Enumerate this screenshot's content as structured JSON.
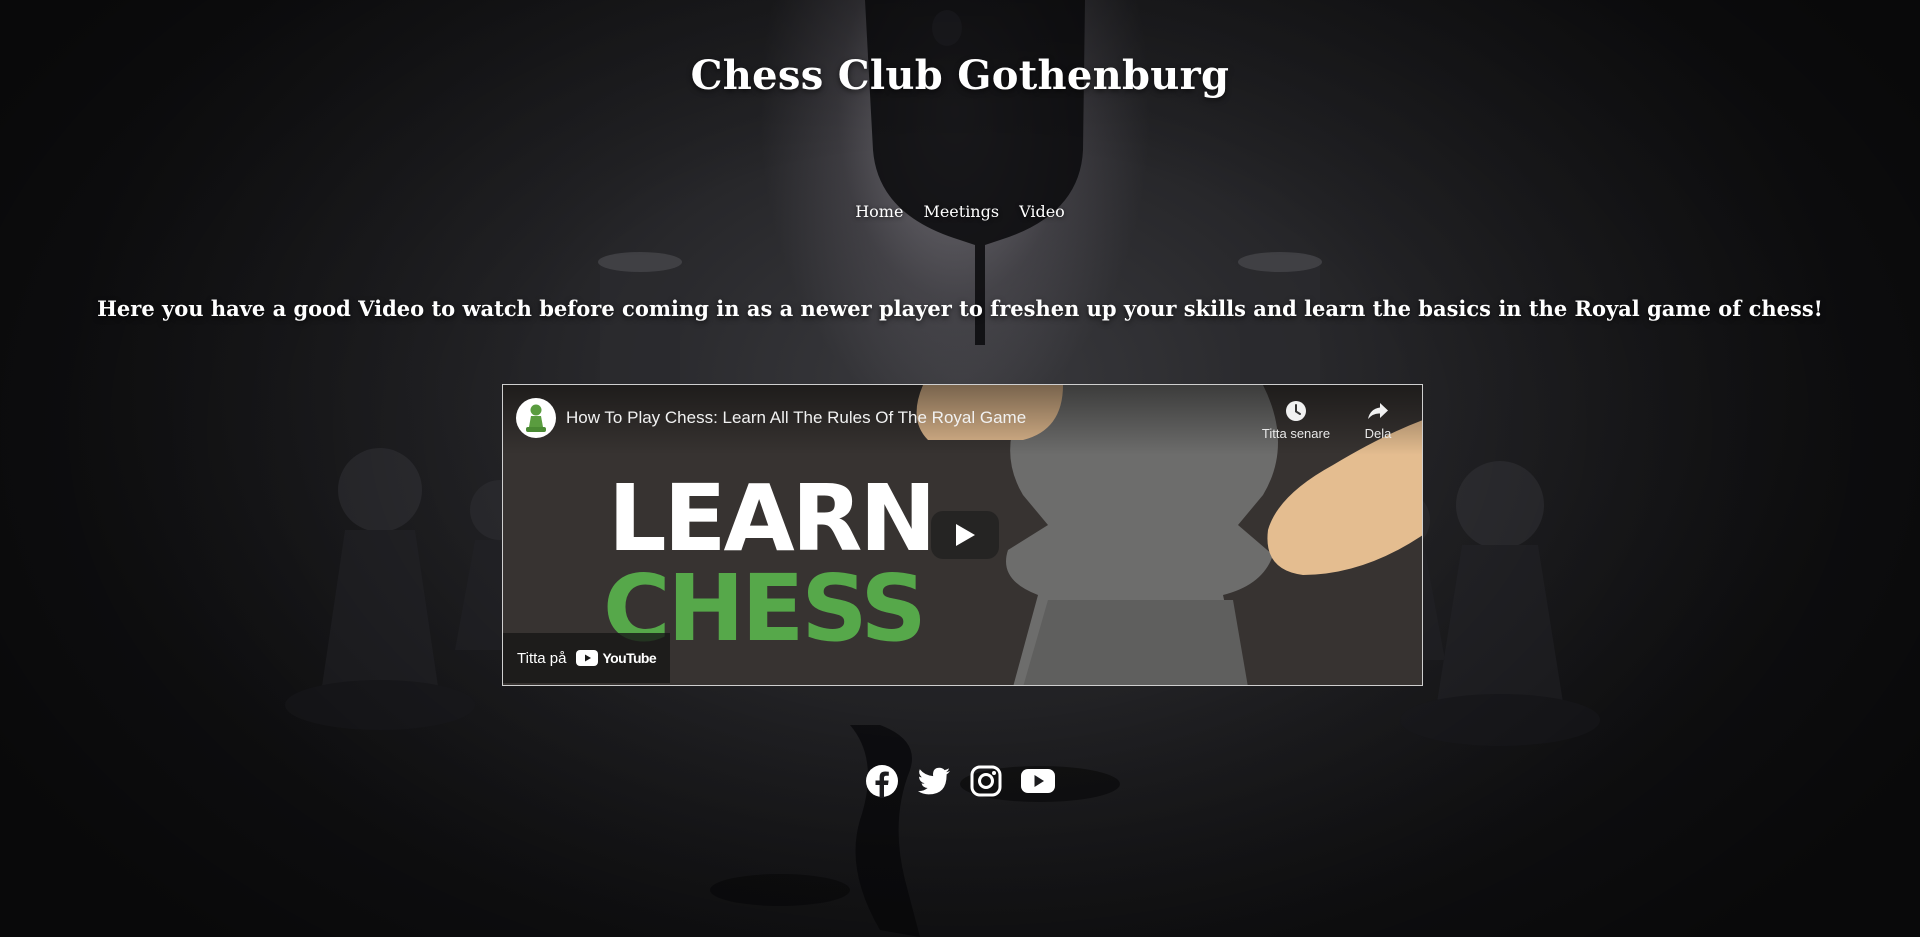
{
  "site": {
    "title": "Chess Club Gothenburg"
  },
  "nav": {
    "items": [
      "Home",
      "Meetings",
      "Video"
    ]
  },
  "intro": {
    "text": "Here you have a good Video to watch before coming in as a newer player to freshen up your skills and learn the basics in the Royal game of chess!"
  },
  "video": {
    "title": "How To Play Chess: Learn All The Rules Of The Royal Game",
    "thumbnail_line1": "LEARN",
    "thumbnail_line2": "CHESS",
    "watch_later_label": "Titta senare",
    "share_label": "Dela",
    "watch_on_label": "Titta på",
    "youtube_wordmark": "YouTube",
    "play_icon": "play-icon",
    "accent_green": "#56a84a"
  },
  "social": {
    "icons": [
      "facebook-icon",
      "twitter-icon",
      "instagram-icon",
      "youtube-icon"
    ]
  }
}
